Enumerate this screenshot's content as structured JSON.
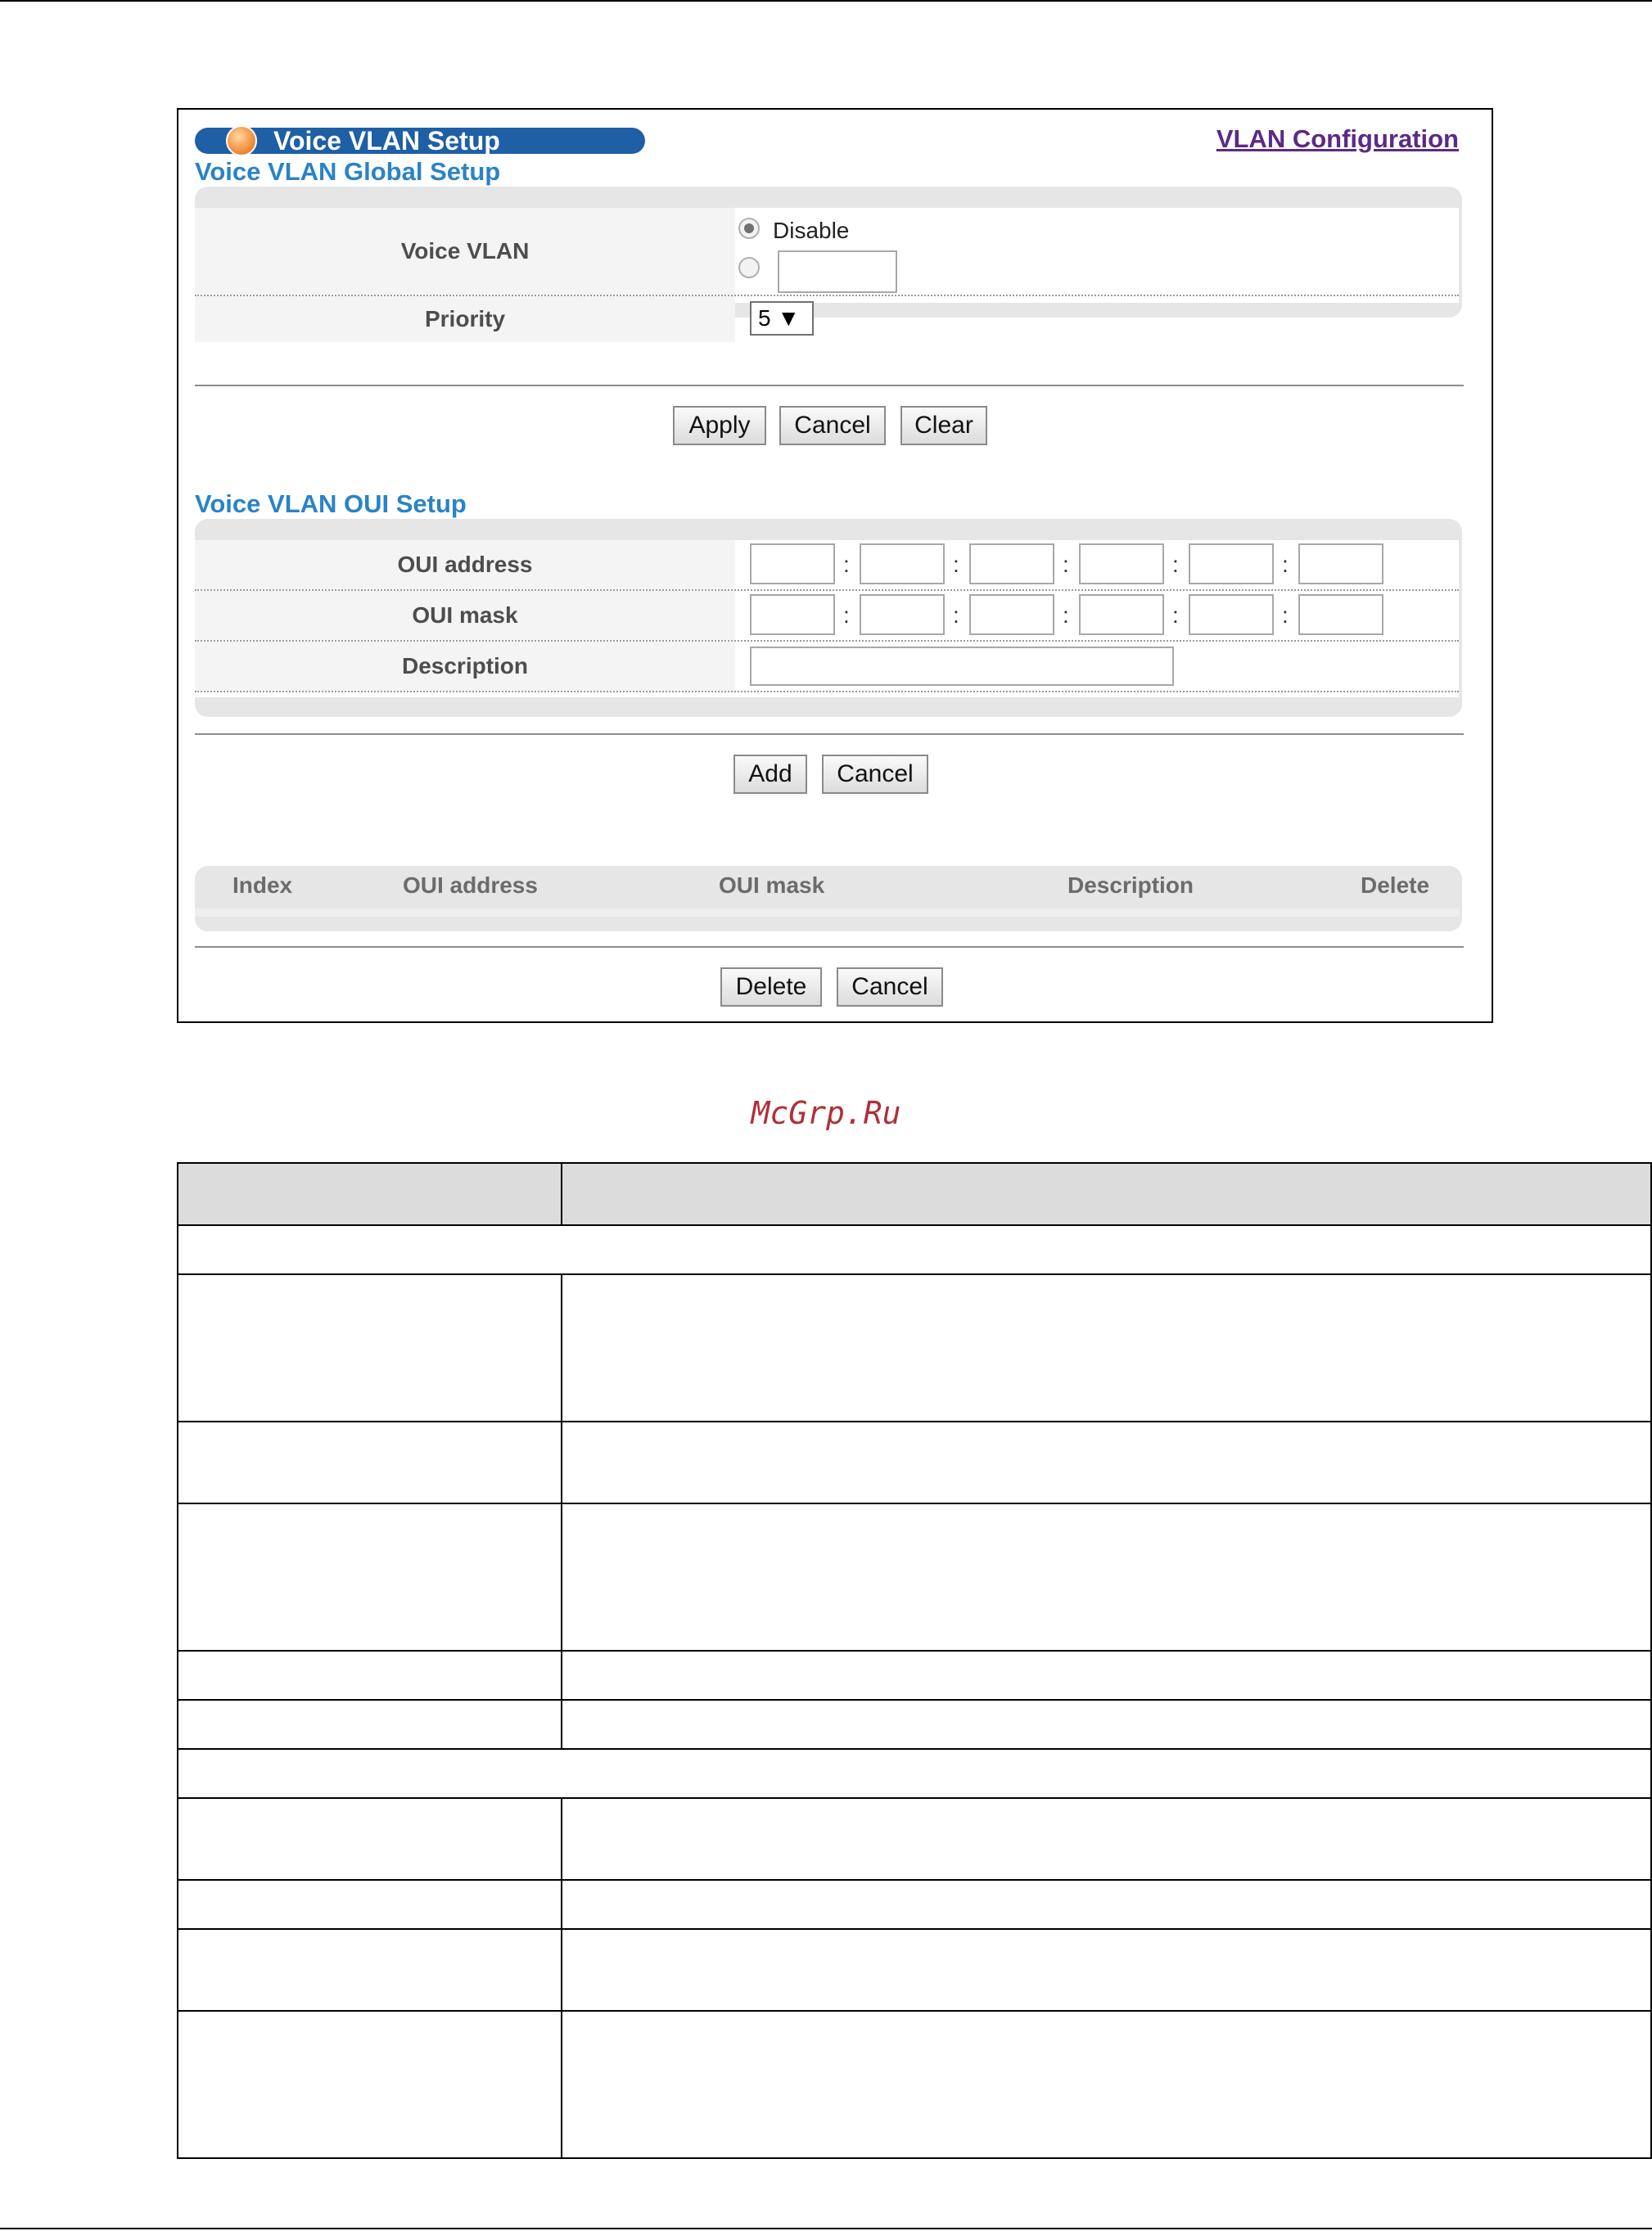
{
  "panel": {
    "title": "Voice VLAN Setup",
    "vlan_link": "VLAN Configuration",
    "global_section": {
      "title": "Voice VLAN Global Setup",
      "voice_vlan_label": "Voice VLAN",
      "disable_option": "Disable",
      "disable_selected": true,
      "vlan_id_value": "",
      "priority_label": "Priority",
      "priority_value": "5 ▼",
      "buttons": {
        "apply": "Apply",
        "cancel": "Cancel",
        "clear": "Clear"
      }
    },
    "oui_section": {
      "title": "Voice VLAN OUI Setup",
      "oui_address_label": "OUI address",
      "oui_mask_label": "OUI mask",
      "description_label": "Description",
      "separator": ":",
      "buttons": {
        "add": "Add",
        "cancel": "Cancel"
      }
    },
    "oui_table": {
      "columns": [
        "Index",
        "OUI address",
        "OUI mask",
        "Description",
        "Delete"
      ],
      "buttons": {
        "delete": "Delete",
        "cancel": "Cancel"
      }
    }
  },
  "watermark": "McGrp.Ru"
}
